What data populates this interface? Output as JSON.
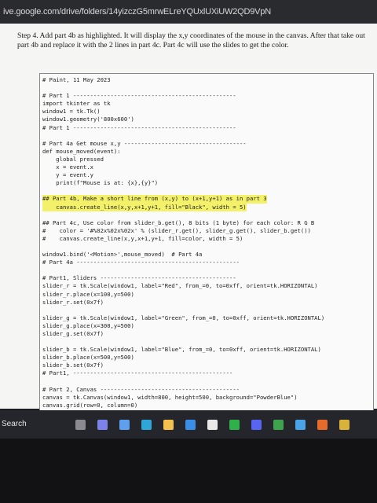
{
  "browser": {
    "url": "ive.google.com/drive/folders/14yizczG5mrwELreYQUxlUXiUW2QD9VpN"
  },
  "instructions": {
    "step_text": "Step 4. Add part 4b as highlighted. It will display the x,y coordinates of the mouse in the canvas. After that take out part 4b and replace it with the 2 lines in part 4c. Part 4c will use the slides to get the color."
  },
  "code": {
    "lines": [
      "# Paint, 11 May 2023",
      "",
      "# Part 1 ------------------------------------------------",
      "import tkinter as tk",
      "window1 = tk.Tk()",
      "window1.geometry('800x600')",
      "# Part 1 ------------------------------------------------",
      "",
      "# Part 4a Get mouse x,y ------------------------------------",
      "def mouse_moved(event):",
      "    global pressed",
      "    x = event.x",
      "    y = event.y",
      "    print(f\"Mouse is at: {x},{y}\")",
      ""
    ],
    "highlight_lines": [
      "## Part 4b, Make a short line from (x,y) to (x+1,y+1) as in part 3",
      "    canvas.create_line(x,y,x+1,y+1, fill=\"Black\", width = 5)"
    ],
    "lines_after": [
      "",
      "## Part 4c, Use color from slider_b.get(), 8 bits (1 byte) for each color: R G B",
      "#    color = '#%02x%02x%02x' % (slider_r.get(), slider_g.get(), slider_b.get())",
      "#    canvas.create_line(x,y,x+1,y+1, fill=color, width = 5)",
      "",
      "window1.bind('<Motion>',mouse_moved)  # Part 4a",
      "# Part 4a ------------------------------------------------",
      "",
      "# Part1, Sliders ----------------------------------------",
      "slider_r = tk.Scale(window1, label=\"Red\", from_=0, to=0xff, orient=tk.HORIZONTAL)",
      "slider_r.place(x=100,y=500)",
      "slider_r.set(0x7f)",
      "",
      "slider_g = tk.Scale(window1, label=\"Green\", from_=0, to=0xff, orient=tk.HORIZONTAL)",
      "slider_g.place(x=300,y=500)",
      "slider_g.set(0x7f)",
      "",
      "slider_b = tk.Scale(window1, label=\"Blue\", from_=0, to=0xff, orient=tk.HORIZONTAL)",
      "slider_b.place(x=500,y=500)",
      "slider_b.set(0x7f)",
      "# Part1, -----------------------------------------------",
      "",
      "# Part 2, Canvas -----------------------------------------",
      "canvas = tk.Canvas(window1, width=800, height=500, background=\"PowderBlue\")",
      "canvas.grid(row=0, column=0)"
    ]
  },
  "taskbar": {
    "search_label": "Search",
    "icons": [
      {
        "name": "task-view-icon",
        "color": "#8a8a90"
      },
      {
        "name": "chat-icon",
        "color": "#7b83eb"
      },
      {
        "name": "widgets-icon",
        "color": "#5ea0ef"
      },
      {
        "name": "edge-icon",
        "color": "#2ea6d8"
      },
      {
        "name": "file-explorer-icon",
        "color": "#f2c14e"
      },
      {
        "name": "store-icon",
        "color": "#3a8ee6"
      },
      {
        "name": "app-icon",
        "color": "#e8e8e8"
      },
      {
        "name": "xbox-icon",
        "color": "#2fb14a"
      },
      {
        "name": "discord-icon",
        "color": "#5865f2"
      },
      {
        "name": "app2-icon",
        "color": "#3fa34d"
      },
      {
        "name": "mail-icon",
        "color": "#4aa3e6"
      },
      {
        "name": "firefox-icon",
        "color": "#e66b2a"
      },
      {
        "name": "settings-icon",
        "color": "#d9b23a"
      }
    ]
  }
}
